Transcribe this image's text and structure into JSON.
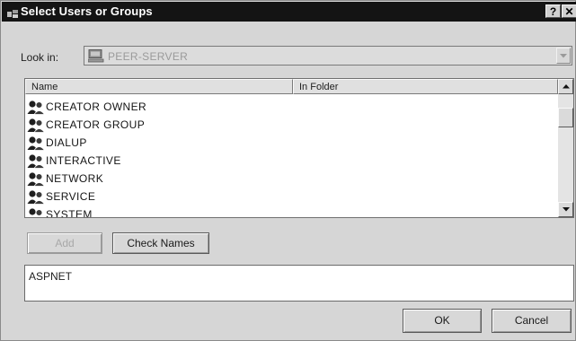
{
  "window": {
    "title": "Select Users or Groups",
    "help_glyph": "?",
    "close_glyph": "✕"
  },
  "lookin": {
    "label": "Look in:",
    "value": "PEER-SERVER"
  },
  "list": {
    "columns": [
      "Name",
      "In Folder"
    ],
    "rows": [
      {
        "name": "CREATOR OWNER",
        "icon": "user-group-icon"
      },
      {
        "name": "CREATOR GROUP",
        "icon": "user-group-icon"
      },
      {
        "name": "DIALUP",
        "icon": "user-group-icon"
      },
      {
        "name": "INTERACTIVE",
        "icon": "user-group-icon"
      },
      {
        "name": "NETWORK",
        "icon": "user-group-icon"
      },
      {
        "name": "SERVICE",
        "icon": "user-group-icon"
      },
      {
        "name": "SYSTEM",
        "icon": "user-group-icon"
      }
    ]
  },
  "buttons": {
    "add": "Add",
    "check_names": "Check Names",
    "ok": "OK",
    "cancel": "Cancel"
  },
  "names_field": {
    "value": "ASPNET"
  }
}
